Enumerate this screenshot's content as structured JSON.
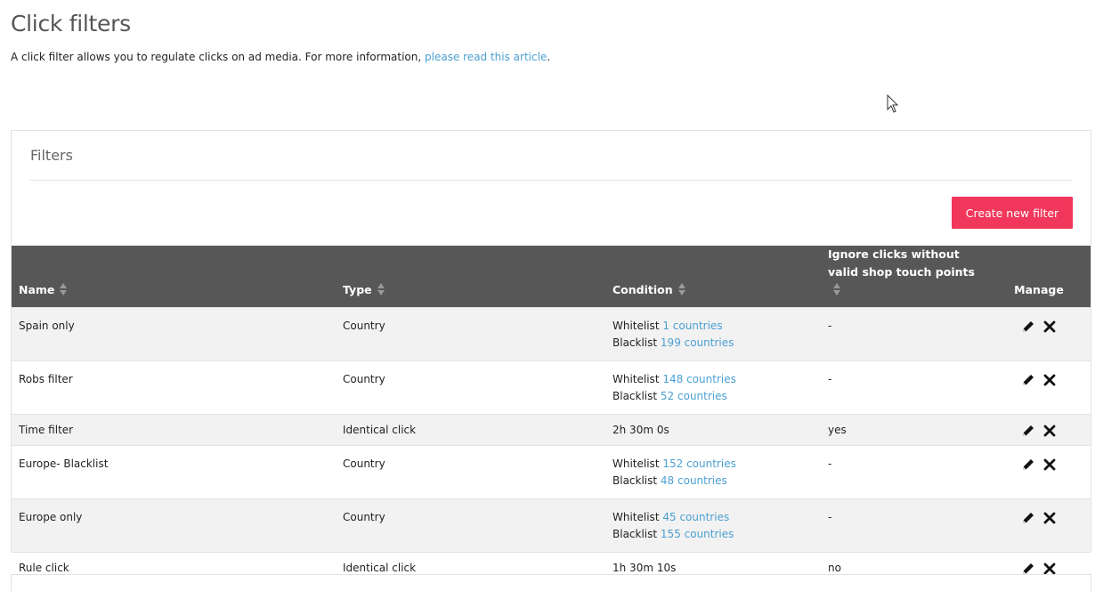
{
  "page": {
    "title": "Click filters",
    "intro_text": "A click filter allows you to regulate clicks on ad media. For more information, ",
    "intro_link": "please read this article",
    "intro_end": "."
  },
  "panel": {
    "title": "Filters",
    "create_button": "Create new filter"
  },
  "table": {
    "columns": {
      "name": "Name",
      "type": "Type",
      "condition": "Condition",
      "ignore_line1": "Ignore clicks without",
      "ignore_line2": "valid shop touch points",
      "manage": "Manage"
    },
    "rows": [
      {
        "name": "Spain only",
        "type": "Country",
        "wl_label": "Whitelist",
        "wl_count": "1 countries",
        "bl_label": "Blacklist",
        "bl_count": "199 countries",
        "ignore": "-"
      },
      {
        "name": "Robs filter",
        "type": "Country",
        "wl_label": "Whitelist",
        "wl_count": "148 countries",
        "bl_label": "Blacklist",
        "bl_count": "52 countries",
        "ignore": "-"
      },
      {
        "name": "Time filter",
        "type": "Identical click",
        "condition": "2h 30m 0s",
        "ignore": "yes"
      },
      {
        "name": "Europe- Blacklist",
        "type": "Country",
        "wl_label": "Whitelist",
        "wl_count": "152 countries",
        "bl_label": "Blacklist",
        "bl_count": "48 countries",
        "ignore": "-"
      },
      {
        "name": "Europe only",
        "type": "Country",
        "wl_label": "Whitelist",
        "wl_count": "45 countries",
        "bl_label": "Blacklist",
        "bl_count": "155 countries",
        "ignore": "-"
      },
      {
        "name": "Rule click",
        "type": "Identical click",
        "condition": "1h 30m 10s",
        "ignore": "no"
      }
    ]
  },
  "icons": {
    "edit": "pencil-icon",
    "delete": "close-icon",
    "sort": "sort-icon",
    "cursor": "mouse-pointer-icon"
  },
  "colors": {
    "accent_button": "#f1375b",
    "link": "#4a9fd2",
    "table_header": "#575757"
  }
}
